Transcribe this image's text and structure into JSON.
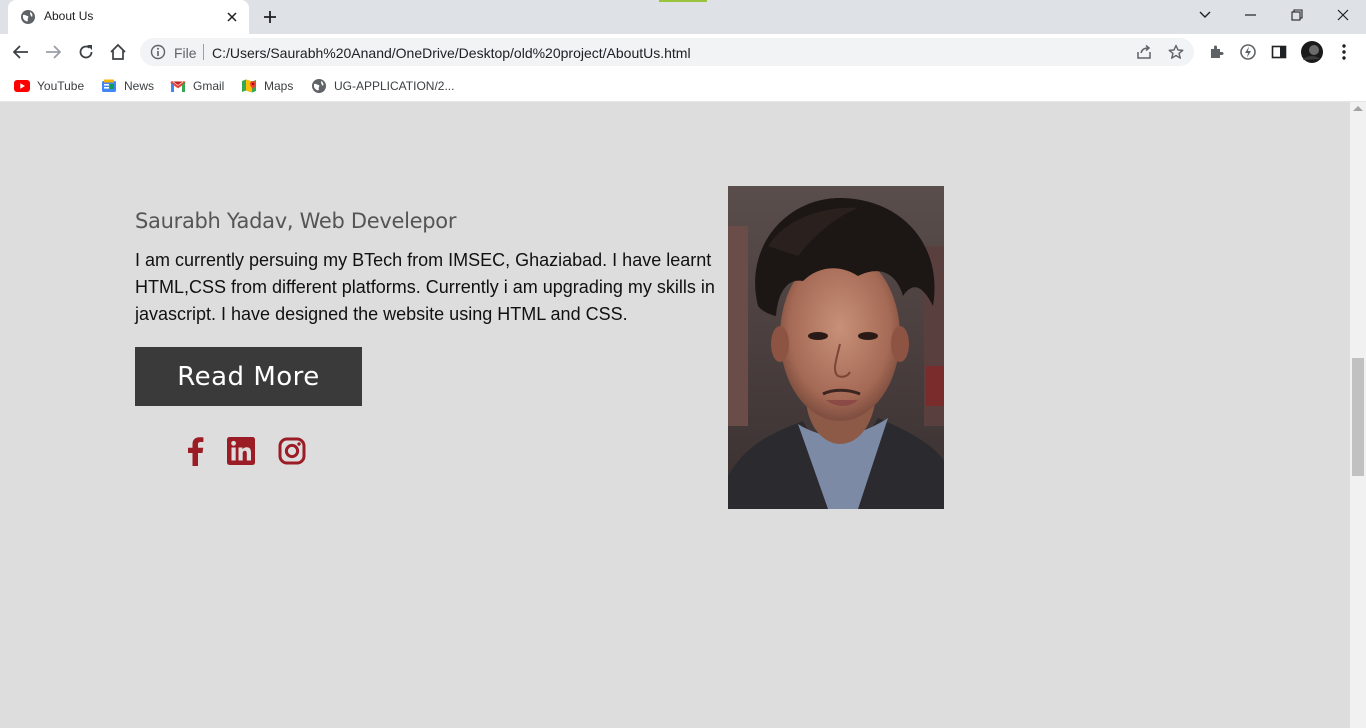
{
  "browser": {
    "tab": {
      "title": "About Us"
    },
    "address": {
      "scheme_label": "File",
      "url": "C:/Users/Saurabh%20Anand/OneDrive/Desktop/old%20project/AboutUs.html"
    },
    "bookmarks": [
      {
        "label": "YouTube",
        "icon": "youtube-icon"
      },
      {
        "label": "News",
        "icon": "news-icon"
      },
      {
        "label": "Gmail",
        "icon": "gmail-icon"
      },
      {
        "label": "Maps",
        "icon": "maps-icon"
      },
      {
        "label": "UG-APPLICATION/2...",
        "icon": "globe-icon"
      }
    ]
  },
  "content": {
    "heading": "Saurabh Yadav, Web Develepor",
    "bio": "I am currently persuing my BTech from IMSEC, Ghaziabad. I have learnt HTML,CSS from different platforms. Currently i am upgrading my skills in javascript. I have designed the website using HTML and CSS.",
    "read_more_label": "Read More",
    "social": [
      "facebook-icon",
      "linkedin-icon",
      "instagram-icon"
    ]
  },
  "colors": {
    "page_background": "#dddddd",
    "button_background": "#3a3a3a",
    "social_icon": "#9b1c24",
    "heading": "#555555"
  }
}
